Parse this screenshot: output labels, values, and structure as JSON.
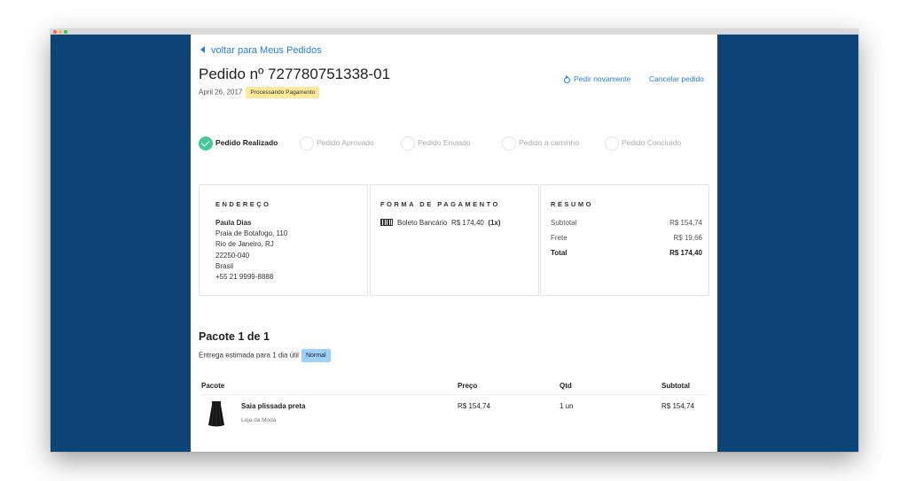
{
  "back_link": "voltar para Meus Pedidos",
  "order": {
    "title": "Pedido nº 727780751338-01",
    "date": "April 26, 2017",
    "status": "Processando Pagamento"
  },
  "actions": {
    "reorder": "Pedir novamente",
    "cancel": "Cancelar pedido"
  },
  "steps": [
    {
      "label": "Pedido Realizado",
      "done": true
    },
    {
      "label": "Pedido Aprovado",
      "done": false
    },
    {
      "label": "Pedido Enviado",
      "done": false
    },
    {
      "label": "Pedido a caminho",
      "done": false
    },
    {
      "label": "Pedido Concluído",
      "done": false
    }
  ],
  "address": {
    "title": "ENDEREÇO",
    "name": "Paula Dias",
    "street": "Praia de Botafogo, 110",
    "city": "Rio de Janeiro, RJ",
    "zip": "22250-040",
    "country": "Brasil",
    "phone": "+55 21 9999-8888"
  },
  "payment": {
    "title": "FORMA DE PAGAMENTO",
    "method": "Boleto Bancário",
    "amount": "R$ 174,40",
    "installments": "(1x)",
    "icon": "barcode-icon"
  },
  "summary": {
    "title": "RESUMO",
    "rows": [
      {
        "label": "Subtotal",
        "value": "R$ 154,74"
      },
      {
        "label": "Frete",
        "value": "R$ 19,66"
      },
      {
        "label": "Total",
        "value": "R$ 174,40"
      }
    ]
  },
  "package": {
    "title": "Pacote 1 de 1",
    "estimate": "Entrega estimada para 1 dia útil",
    "shipping_type": "Normal"
  },
  "table": {
    "headers": {
      "package": "Pacote",
      "price": "Preço",
      "qty": "Qtd",
      "subtotal": "Subtotal"
    },
    "rows": [
      {
        "name": "Saia plissada preta",
        "store": "Loja da Moda",
        "price": "R$ 154,74",
        "qty": "1 un",
        "subtotal": "R$ 154,74"
      }
    ]
  },
  "colors": {
    "side_panels": "#0d4477",
    "link": "#2a7fd4",
    "step_done": "#45c99a",
    "status_badge": "#fde99a",
    "shipping_badge": "#9dd0fb"
  }
}
